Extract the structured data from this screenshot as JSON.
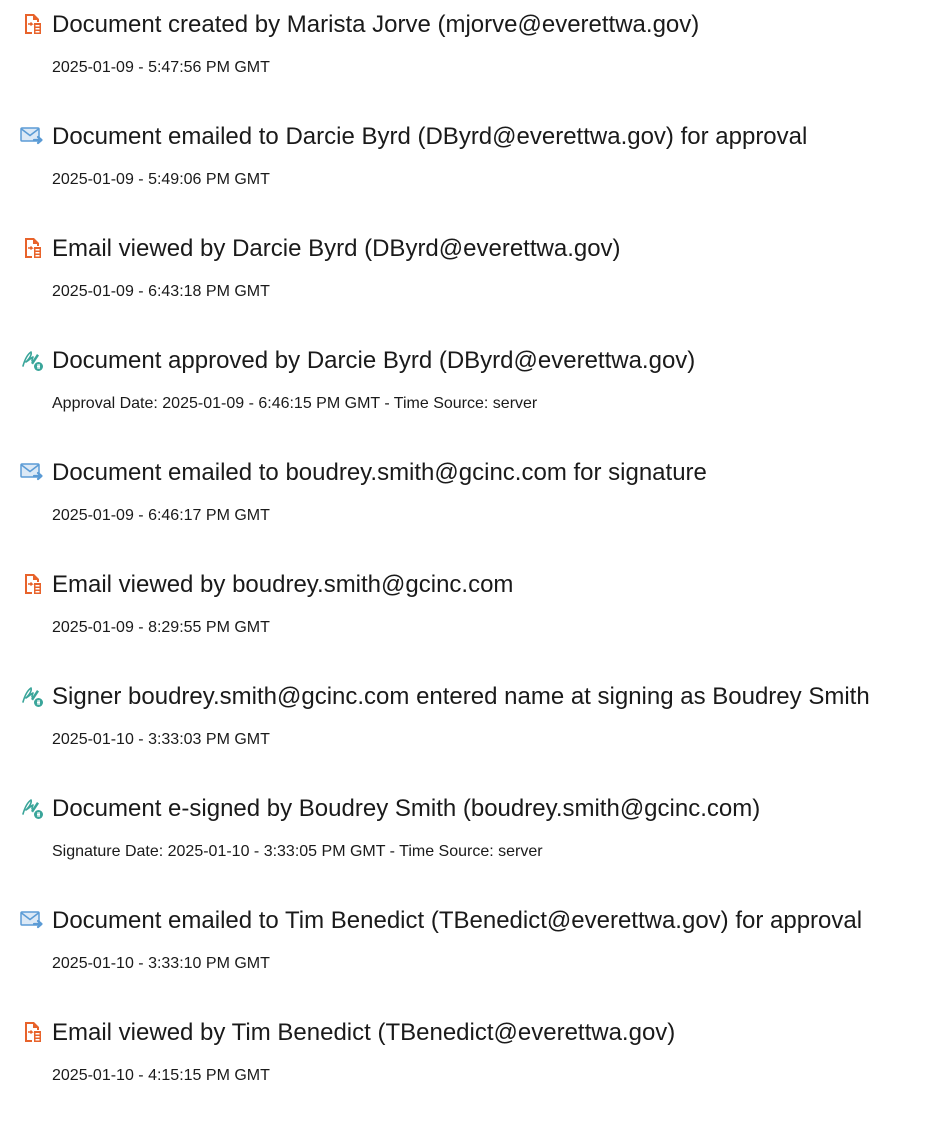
{
  "events": [
    {
      "icon": "document-created-icon",
      "title": "Document created by Marista Jorve (mjorve@everettwa.gov)",
      "detail": "2025-01-09 - 5:47:56 PM GMT"
    },
    {
      "icon": "email-sent-icon",
      "title": "Document emailed to Darcie Byrd (DByrd@everettwa.gov) for approval",
      "detail": "2025-01-09 - 5:49:06 PM GMT"
    },
    {
      "icon": "document-viewed-icon",
      "title": "Email viewed by Darcie Byrd (DByrd@everettwa.gov)",
      "detail": "2025-01-09 - 6:43:18 PM GMT"
    },
    {
      "icon": "signature-icon",
      "title": "Document approved by Darcie Byrd (DByrd@everettwa.gov)",
      "detail": "Approval Date: 2025-01-09 - 6:46:15 PM GMT - Time Source: server"
    },
    {
      "icon": "email-sent-icon",
      "title": "Document emailed to boudrey.smith@gcinc.com for signature",
      "detail": "2025-01-09 - 6:46:17 PM GMT"
    },
    {
      "icon": "document-viewed-icon",
      "title": "Email viewed by boudrey.smith@gcinc.com",
      "detail": "2025-01-09 - 8:29:55 PM GMT"
    },
    {
      "icon": "signature-icon",
      "title": "Signer boudrey.smith@gcinc.com entered name at signing as Boudrey Smith",
      "detail": "2025-01-10 - 3:33:03 PM GMT"
    },
    {
      "icon": "signature-icon",
      "title": "Document e-signed by Boudrey Smith (boudrey.smith@gcinc.com)",
      "detail": "Signature Date: 2025-01-10 - 3:33:05 PM GMT - Time Source: server"
    },
    {
      "icon": "email-sent-icon",
      "title": "Document emailed to Tim Benedict (TBenedict@everettwa.gov) for approval",
      "detail": "2025-01-10 - 3:33:10 PM GMT"
    },
    {
      "icon": "document-viewed-icon",
      "title": "Email viewed by Tim Benedict (TBenedict@everettwa.gov)",
      "detail": "2025-01-10 - 4:15:15 PM GMT"
    }
  ],
  "colors": {
    "document_icon": "#e8632b",
    "email_icon": "#5b9bd5",
    "signature_icon": "#3aa59a",
    "text": "#1a1a1a"
  }
}
